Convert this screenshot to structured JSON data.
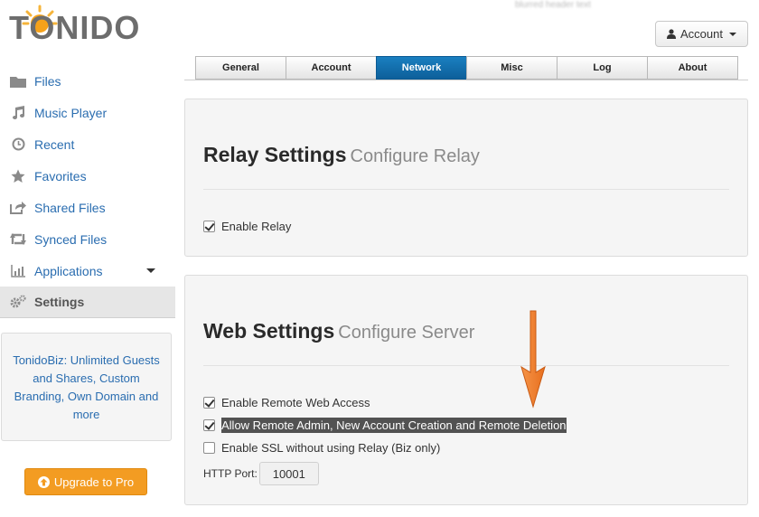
{
  "brand": {
    "logo_text": "TONIDO"
  },
  "header": {
    "blurred_text": "blurred header text",
    "account_label": "Account"
  },
  "sidebar": {
    "items": [
      {
        "label": "Files",
        "icon": "folder-icon"
      },
      {
        "label": "Music Player",
        "icon": "music-note-icon"
      },
      {
        "label": "Recent",
        "icon": "clock-icon"
      },
      {
        "label": "Favorites",
        "icon": "star-icon"
      },
      {
        "label": "Shared Files",
        "icon": "share-icon"
      },
      {
        "label": "Synced Files",
        "icon": "sync-icon"
      },
      {
        "label": "Applications",
        "icon": "chart-icon"
      },
      {
        "label": "Settings",
        "icon": "gears-icon"
      }
    ],
    "promo": "TonidoBiz: Unlimited Guests and Shares, Custom Branding, Own Domain and more",
    "upgrade_label": "Upgrade to Pro"
  },
  "tabs": [
    {
      "label": "General"
    },
    {
      "label": "Account"
    },
    {
      "label": "Network",
      "active": true
    },
    {
      "label": "Misc"
    },
    {
      "label": "Log"
    },
    {
      "label": "About"
    }
  ],
  "relay": {
    "title": "Relay Settings",
    "subtitle": "Configure Relay",
    "enable_relay_label": "Enable Relay",
    "enable_relay_checked": true
  },
  "web": {
    "title": "Web Settings",
    "subtitle": "Configure Server",
    "remote_web_label": "Enable Remote Web Access",
    "remote_web_checked": true,
    "remote_admin_label": "Allow Remote Admin, New Account Creation and Remote Deletion",
    "remote_admin_checked": true,
    "ssl_label": "Enable SSL without using Relay (Biz only)",
    "ssl_checked": false,
    "port_label": "HTTP Port:",
    "port_value": "10001"
  },
  "colors": {
    "accent": "#0d5f9a",
    "link": "#2a6db0",
    "upgrade": "#f39c22",
    "arrow": "#f08030"
  }
}
